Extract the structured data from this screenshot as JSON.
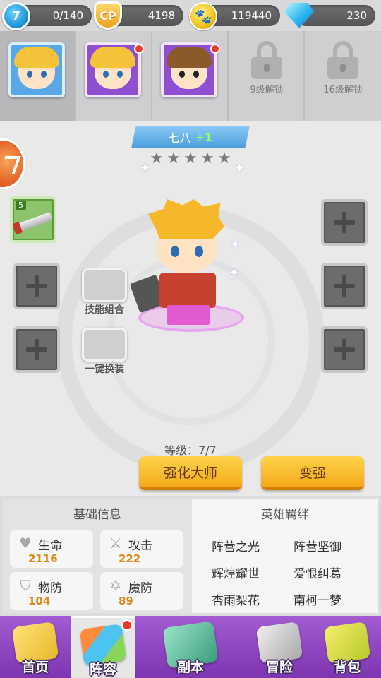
{
  "resources": {
    "player_level": "7",
    "energy": "0/140",
    "cp_label": "CP",
    "cp": "4198",
    "gold": "119440",
    "gems": "230"
  },
  "slots": {
    "unlock_9": "9级解锁",
    "unlock_16": "16级解锁"
  },
  "hero": {
    "name": "七八",
    "plus": "+1",
    "stars": 5,
    "weapon_count": "5",
    "skill_combo_label": "技能组合",
    "one_click_equip_label": "一键换装",
    "level_text": "等级：7/7",
    "btn_master": "强化大师",
    "btn_strengthen": "变强"
  },
  "info": {
    "basic_title": "基础信息",
    "bond_title": "英雄羁绊",
    "stats": [
      {
        "label": "生命",
        "value": "2116",
        "icon": "heart-icon"
      },
      {
        "label": "攻击",
        "value": "222",
        "icon": "sword-icon"
      },
      {
        "label": "物防",
        "value": "104",
        "icon": "shield-icon"
      },
      {
        "label": "魔防",
        "value": "89",
        "icon": "magic-star-icon"
      }
    ],
    "bonds": [
      "阵营之光",
      "阵营坚御",
      "辉煌耀世",
      "爱恨纠葛",
      "杏雨梨花",
      "南柯一梦"
    ]
  },
  "nav": {
    "home": "首页",
    "team": "阵容",
    "dungeon": "副本",
    "adventure": "冒险",
    "bag": "背包"
  }
}
